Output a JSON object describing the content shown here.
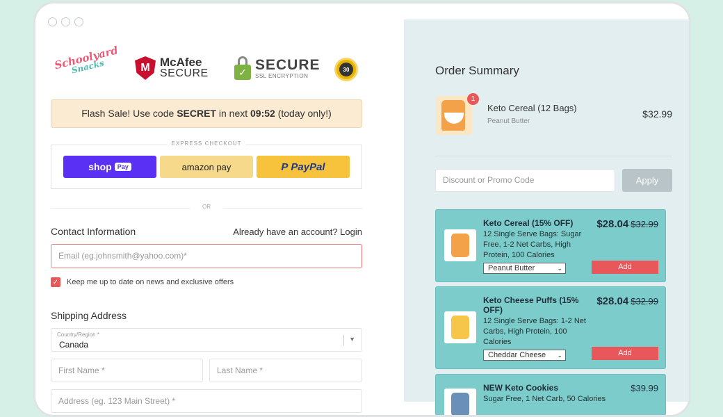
{
  "brand": {
    "logo_line1": "Schoolyard",
    "logo_line2": "Snacks",
    "mcafee_line1": "McAfee",
    "mcafee_line2": "SECURE",
    "secure_line1": "SECURE",
    "secure_line2": "SSL ENCRYPTION",
    "badge_text": "30"
  },
  "flash": {
    "prefix": "Flash Sale! Use code ",
    "code": "SECRET",
    "middle": " in next ",
    "timer": "09:52",
    "suffix": " (today only!)"
  },
  "express": {
    "label": "EXPRESS CHECKOUT",
    "shop": "shop",
    "shop_pay": "Pay",
    "amazon": "amazon pay",
    "paypal": "PayPal"
  },
  "or_label": "OR",
  "contact": {
    "title": "Contact Information",
    "login_text": "Already have an account? Login",
    "email_placeholder": "Email (eg.johnsmith@yahoo.com)*",
    "newsletter_label": "Keep me up to date on news and exclusive offers"
  },
  "shipping": {
    "title": "Shipping Address",
    "country_label": "Country/Region *",
    "country_value": "Canada",
    "first_name_placeholder": "First Name *",
    "last_name_placeholder": "Last Name *",
    "address_placeholder": "Address (eg. 123 Main Street) *"
  },
  "summary": {
    "title": "Order Summary",
    "item": {
      "qty": "1",
      "name": "Keto Cereal (12 Bags)",
      "variant": "Peanut Butter",
      "price": "$32.99"
    },
    "promo_placeholder": "Discount or Promo Code",
    "apply_label": "Apply"
  },
  "upsells": [
    {
      "name": "Keto Cereal (15% OFF)",
      "desc": "12 Single Serve Bags: Sugar Free, 1-2 Net Carbs, High Protein, 100 Calories",
      "option": "Peanut Butter",
      "price": "$28.04",
      "old_price": "$32.99",
      "add_label": "Add"
    },
    {
      "name": "Keto Cheese Puffs (15% OFF)",
      "desc": "12 Single Serve Bags: 1-2 Net Carbs, High Protein, 100 Calories",
      "option": "Cheddar Cheese",
      "price": "$28.04",
      "old_price": "$32.99",
      "add_label": "Add"
    },
    {
      "name": "NEW Keto Cookies",
      "desc": "Sugar Free, 1 Net Carb, 50 Calories",
      "price": "$39.99"
    }
  ],
  "colors": {
    "accent": "#e8585b",
    "upsell_bg": "#7ccccb",
    "page_bg": "#d7f0e7",
    "summary_bg": "#e3eef1"
  }
}
